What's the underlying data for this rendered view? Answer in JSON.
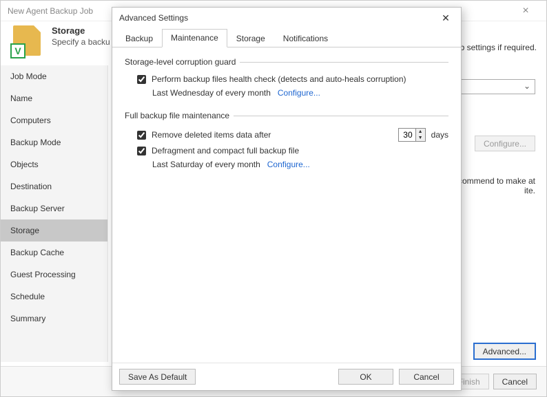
{
  "wizard": {
    "title": "New Agent Backup Job",
    "header_title": "Storage",
    "header_subtitle_left": "Specify a backu",
    "header_subtitle_right": "ob settings if required.",
    "sidebar": [
      "Job Mode",
      "Name",
      "Computers",
      "Backup Mode",
      "Objects",
      "Destination",
      "Backup Server",
      "Storage",
      "Backup Cache",
      "Guest Processing",
      "Schedule",
      "Summary"
    ],
    "selected_sidebar_index": 7,
    "configure_btn": "Configure...",
    "main_line1": "ecommend to make at",
    "main_line2": "ite.",
    "advanced_btn": "Advanced...",
    "footer": {
      "finish": "Finish",
      "cancel": "Cancel"
    }
  },
  "dialog": {
    "title": "Advanced Settings",
    "tabs": [
      "Backup",
      "Maintenance",
      "Storage",
      "Notifications"
    ],
    "active_tab_index": 1,
    "group1": {
      "legend": "Storage-level corruption guard",
      "opt1": "Perform backup files health check (detects and auto-heals corruption)",
      "opt1_checked": true,
      "sched": "Last Wednesday of every month",
      "configure": "Configure..."
    },
    "group2": {
      "legend": "Full backup file maintenance",
      "opt1": "Remove deleted items data after",
      "opt1_checked": true,
      "days_value": "30",
      "days_label": "days",
      "opt2": "Defragment and compact full backup file",
      "opt2_checked": true,
      "sched": "Last Saturday of every month",
      "configure": "Configure..."
    },
    "footer": {
      "save_default": "Save As Default",
      "ok": "OK",
      "cancel": "Cancel"
    }
  }
}
